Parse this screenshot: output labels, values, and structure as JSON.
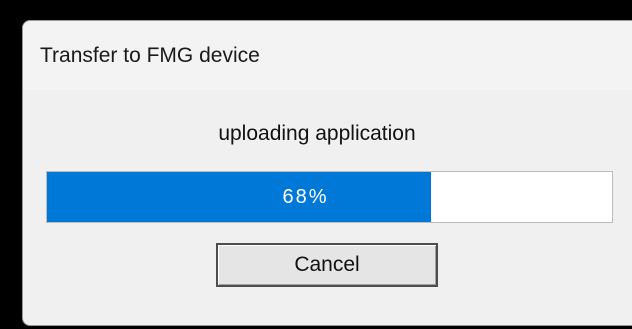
{
  "window": {
    "title": "Transfer to FMG device"
  },
  "status": {
    "message": "uploading application"
  },
  "progress": {
    "percent": 68,
    "label": "68%",
    "fill_color": "#0078d7"
  },
  "buttons": {
    "cancel_label": "Cancel"
  }
}
